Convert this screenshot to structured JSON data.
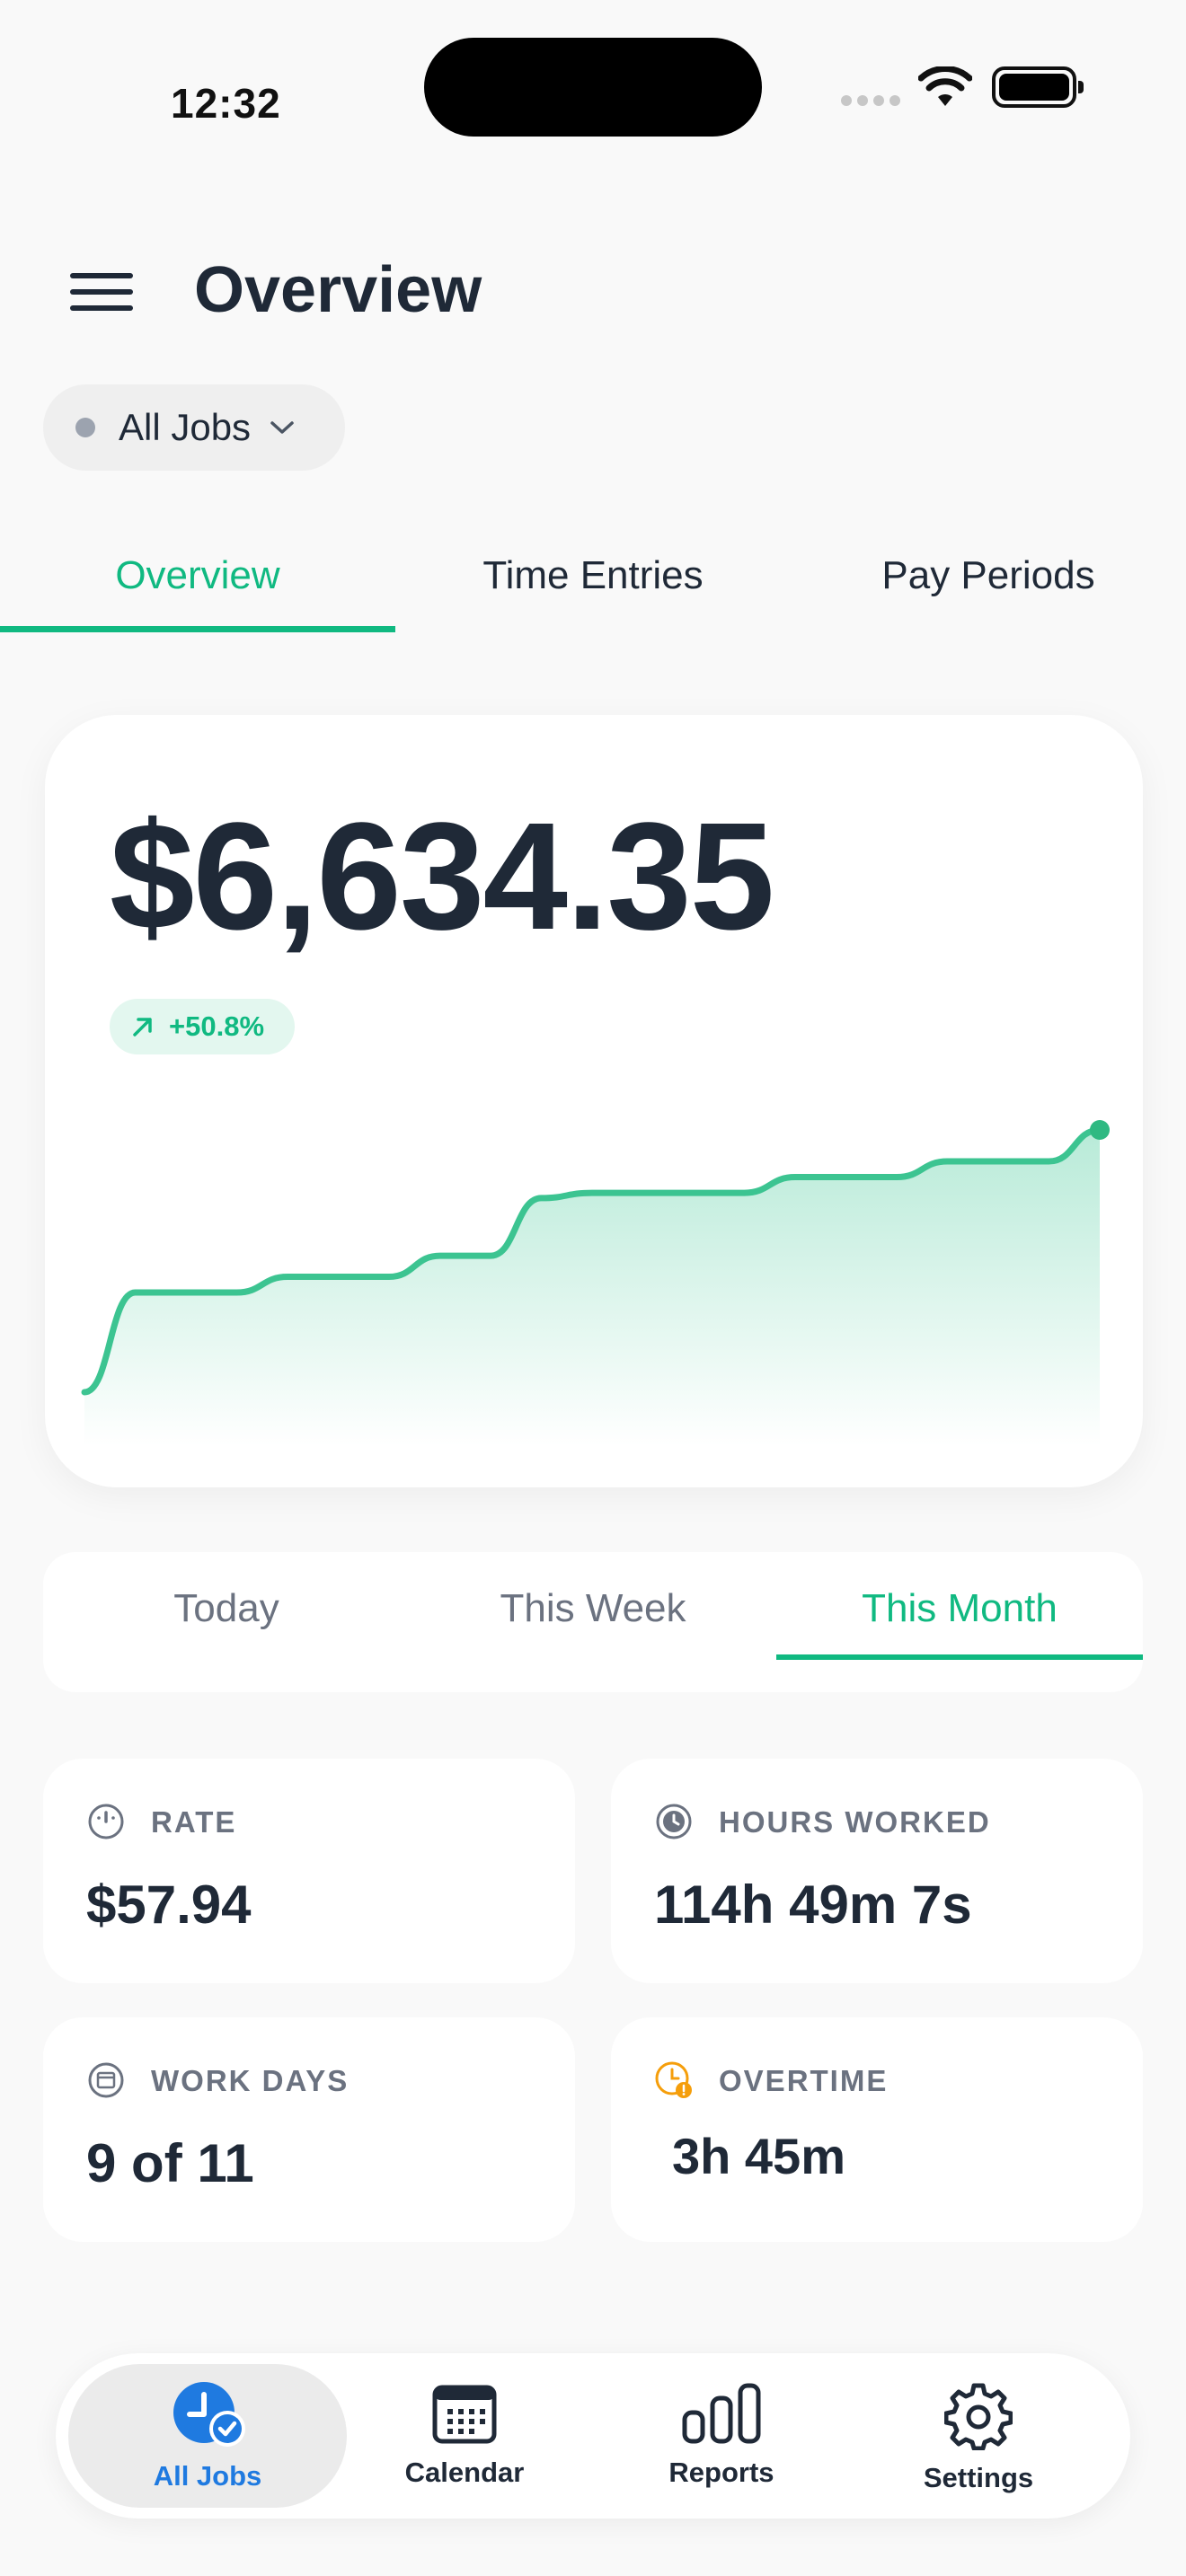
{
  "status_bar": {
    "time": "12:32"
  },
  "header": {
    "title": "Overview"
  },
  "job_filter": {
    "label": "All Jobs"
  },
  "tabs": [
    {
      "label": "Overview",
      "active": true
    },
    {
      "label": "Time Entries",
      "active": false
    },
    {
      "label": "Pay Periods",
      "active": false
    }
  ],
  "earnings": {
    "amount": "$6,634.35",
    "change": "+50.8%",
    "accent_color": "#10b981"
  },
  "chart_data": {
    "type": "area",
    "title": "",
    "xlabel": "",
    "ylabel": "",
    "series": [
      {
        "values": [
          0,
          38,
          38,
          38,
          44,
          44,
          44,
          52,
          52,
          74,
          76,
          76,
          76,
          76,
          82,
          82,
          82,
          88,
          88,
          88,
          100
        ]
      }
    ],
    "grid": false,
    "legend": "none"
  },
  "period_tabs": [
    {
      "label": "Today",
      "active": false
    },
    {
      "label": "This Week",
      "active": false
    },
    {
      "label": "This Month",
      "active": true
    }
  ],
  "stats": {
    "rate": {
      "label": "RATE",
      "value": "$57.94",
      "icon": "speedometer-icon"
    },
    "hours": {
      "label": "HOURS WORKED",
      "value": "114h 49m 7s",
      "icon": "clock-icon"
    },
    "work_days": {
      "label": "WORK DAYS",
      "value": "9 of 11",
      "icon": "calendar-icon"
    },
    "overtime": {
      "label": "OVERTIME",
      "value": "3h 45m",
      "icon": "clock-alert-icon",
      "color": "#f59e0b"
    }
  },
  "nav": {
    "items": [
      {
        "label": "All Jobs",
        "icon": "clock-check-icon",
        "active": true
      },
      {
        "label": "Calendar",
        "icon": "calendar-icon",
        "active": false
      },
      {
        "label": "Reports",
        "icon": "bar-chart-icon",
        "active": false
      },
      {
        "label": "Settings",
        "icon": "gear-icon",
        "active": false
      }
    ],
    "active_color": "#1f7ae0"
  }
}
